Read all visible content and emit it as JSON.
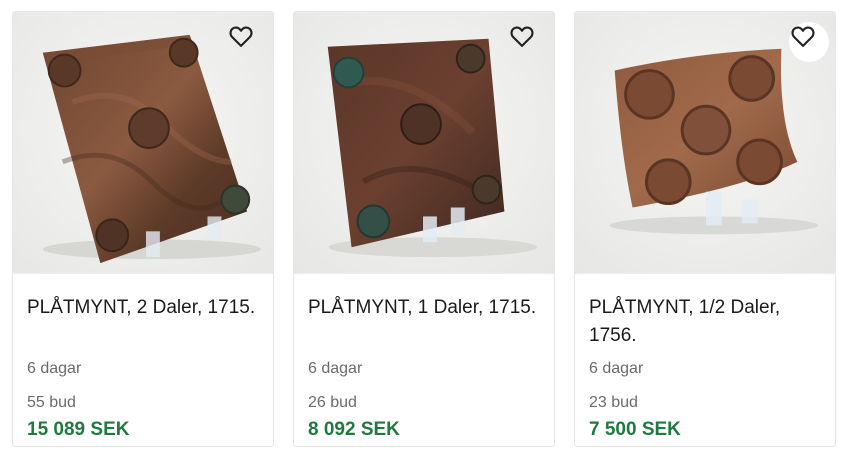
{
  "listings": [
    {
      "title": "PLÅTMYNT, 2 Daler, 1715.",
      "time_left": "6 dagar",
      "bids": "55 bud",
      "price": "15 089 SEK",
      "favorite_icon": "heart-outline-icon",
      "favorite_active": false
    },
    {
      "title": "PLÅTMYNT, 1 Daler, 1715.",
      "time_left": "6 dagar",
      "bids": "26 bud",
      "price": "8 092 SEK",
      "favorite_icon": "heart-outline-icon",
      "favorite_active": false
    },
    {
      "title": "PLÅTMYNT, 1/2 Daler, 1756.",
      "time_left": "6 dagar",
      "bids": "23 bud",
      "price": "7 500 SEK",
      "favorite_icon": "heart-outline-icon",
      "favorite_active": false
    }
  ],
  "colors": {
    "price": "#1e7a3e",
    "muted": "#6b6b6b",
    "photo_bg": "#eeeeec"
  }
}
